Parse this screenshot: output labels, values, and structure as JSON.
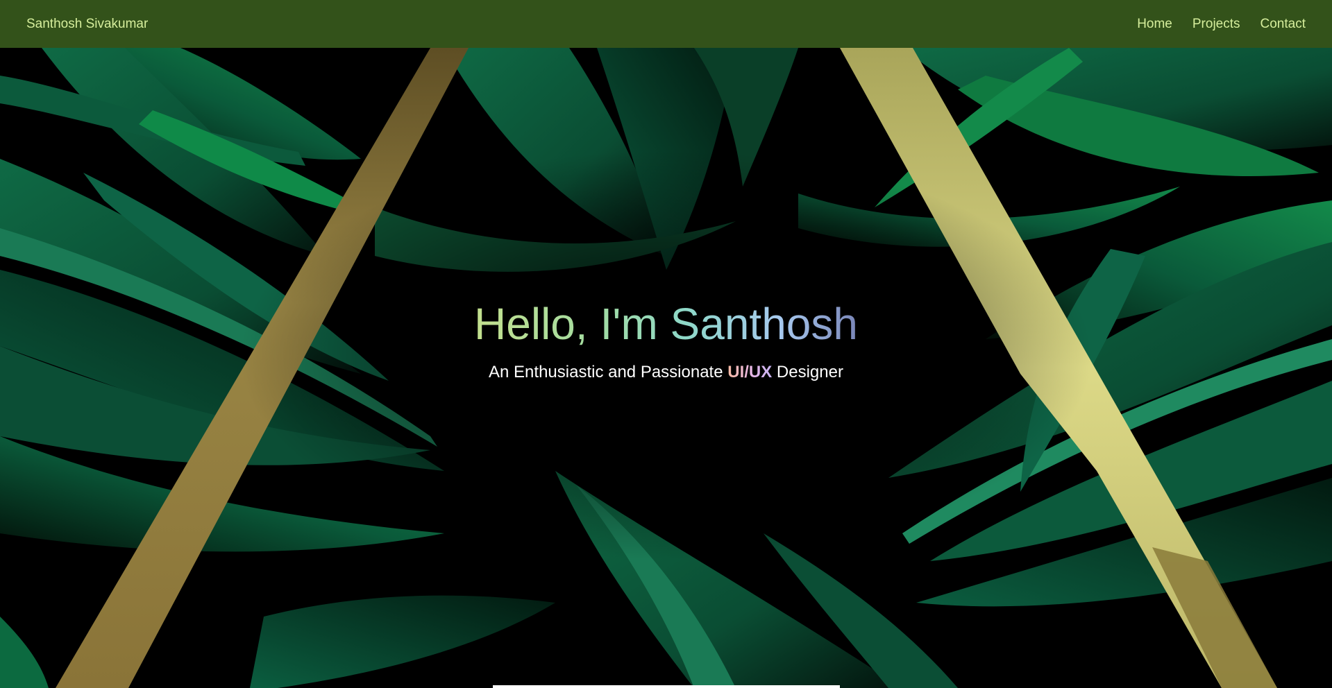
{
  "navbar": {
    "brand": "Santhosh Sivakumar",
    "links": [
      {
        "label": "Home"
      },
      {
        "label": "Projects"
      },
      {
        "label": "Contact"
      }
    ]
  },
  "hero": {
    "headline": "Hello, I'm Santhosh",
    "subline_prefix": "An Enthusiastic and Passionate ",
    "subline_role": "UI/UX",
    "subline_suffix": " Designer"
  },
  "colors": {
    "navbar_bg": "#33521a",
    "nav_text": "#d6ee9c",
    "leaf_green": "#0a5a3a",
    "stripe_gold": "#9a8645",
    "stripe_yellow": "#d9d680"
  }
}
